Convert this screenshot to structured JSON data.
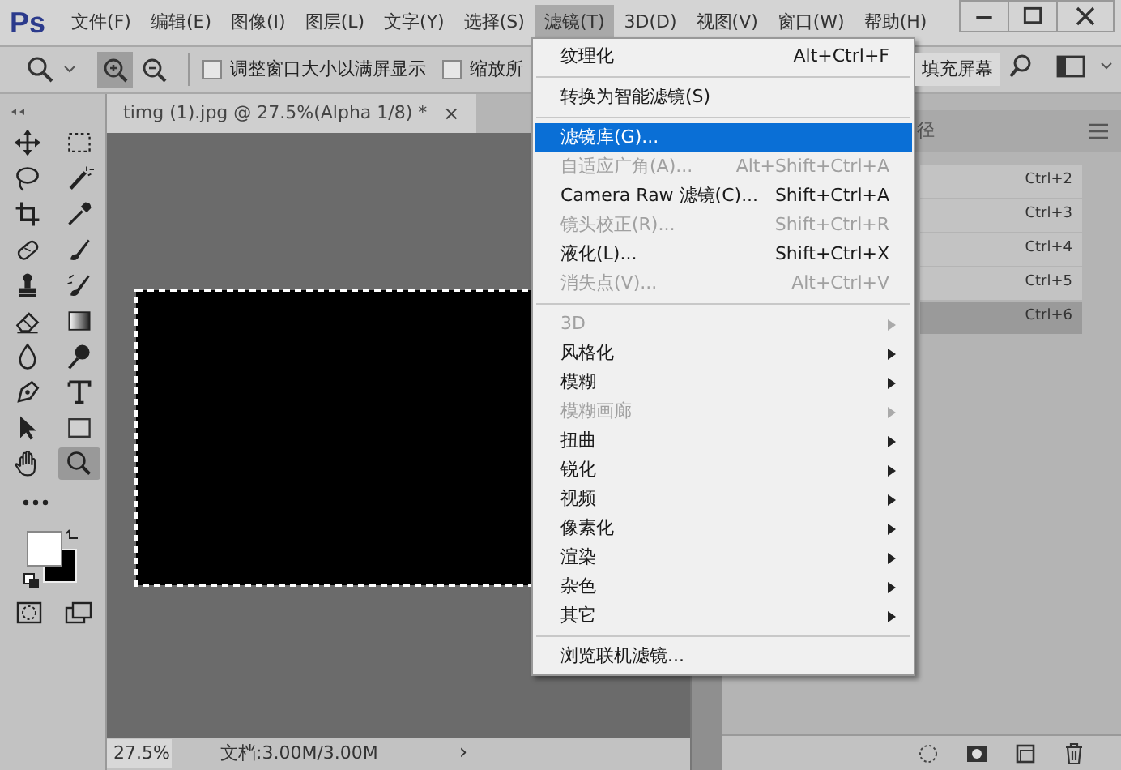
{
  "app": {
    "logo": "Ps"
  },
  "menubar": [
    {
      "label": "文件(F)",
      "selected": false
    },
    {
      "label": "编辑(E)",
      "selected": false
    },
    {
      "label": "图像(I)",
      "selected": false
    },
    {
      "label": "图层(L)",
      "selected": false
    },
    {
      "label": "文字(Y)",
      "selected": false
    },
    {
      "label": "选择(S)",
      "selected": false
    },
    {
      "label": "滤镜(T)",
      "selected": true
    },
    {
      "label": "3D(D)",
      "selected": false
    },
    {
      "label": "视图(V)",
      "selected": false
    },
    {
      "label": "窗口(W)",
      "selected": false
    },
    {
      "label": "帮助(H)",
      "selected": false
    }
  ],
  "options_bar": {
    "zoom_modes": [
      {
        "kind": "in",
        "selected": true
      },
      {
        "kind": "out",
        "selected": false
      }
    ],
    "checkboxes": [
      {
        "label": "调整窗口大小以满屏显示",
        "checked": false
      },
      {
        "label": "缩放所",
        "checked": false
      }
    ],
    "button": "填充屏幕"
  },
  "tools": [
    {
      "kind": "move",
      "selected": false
    },
    {
      "kind": "marquee",
      "selected": false
    },
    {
      "kind": "lasso",
      "selected": false
    },
    {
      "kind": "wand",
      "selected": false
    },
    {
      "kind": "crop",
      "selected": false
    },
    {
      "kind": "eyedropper",
      "selected": false
    },
    {
      "kind": "healing",
      "selected": false
    },
    {
      "kind": "brush",
      "selected": false
    },
    {
      "kind": "stamp",
      "selected": false
    },
    {
      "kind": "history",
      "selected": false
    },
    {
      "kind": "eraser",
      "selected": false
    },
    {
      "kind": "gradient",
      "selected": false
    },
    {
      "kind": "blur",
      "selected": false
    },
    {
      "kind": "dodge",
      "selected": false
    },
    {
      "kind": "pen",
      "selected": false
    },
    {
      "kind": "type",
      "selected": false
    },
    {
      "kind": "select",
      "selected": false
    },
    {
      "kind": "shape",
      "selected": false
    },
    {
      "kind": "hand",
      "selected": false
    },
    {
      "kind": "zoom",
      "selected": true
    }
  ],
  "document_tab": {
    "title": "timg (1).jpg @ 27.5%(Alpha 1/8) *",
    "close": "×"
  },
  "status_bar": {
    "zoom": "27.5%",
    "info": "文档:3.00M/3.00M",
    "arrow": "›"
  },
  "panel": {
    "tab": "径",
    "rows": [
      {
        "shortcut": "Ctrl+2",
        "selected": false
      },
      {
        "shortcut": "Ctrl+3",
        "selected": false
      },
      {
        "shortcut": "Ctrl+4",
        "selected": false
      },
      {
        "shortcut": "Ctrl+5",
        "selected": false
      },
      {
        "shortcut": "Ctrl+6",
        "selected": true
      }
    ]
  },
  "filter_menu": [
    {
      "kind": "item",
      "label": "纹理化",
      "shortcut": "Alt+Ctrl+F",
      "disabled": false,
      "selected": false
    },
    {
      "kind": "separator"
    },
    {
      "kind": "item",
      "label": "转换为智能滤镜(S)",
      "disabled": false,
      "selected": false
    },
    {
      "kind": "separator"
    },
    {
      "kind": "item",
      "label": "滤镜库(G)...",
      "disabled": false,
      "selected": true
    },
    {
      "kind": "item",
      "label": "自适应广角(A)...",
      "shortcut": "Alt+Shift+Ctrl+A",
      "disabled": true,
      "selected": false
    },
    {
      "kind": "item",
      "label": "Camera Raw 滤镜(C)...",
      "shortcut": "Shift+Ctrl+A",
      "disabled": false,
      "selected": false
    },
    {
      "kind": "item",
      "label": "镜头校正(R)...",
      "shortcut": "Shift+Ctrl+R",
      "disabled": true,
      "selected": false
    },
    {
      "kind": "item",
      "label": "液化(L)...",
      "shortcut": "Shift+Ctrl+X",
      "disabled": false,
      "selected": false
    },
    {
      "kind": "item",
      "label": "消失点(V)...",
      "shortcut": "Alt+Ctrl+V",
      "disabled": true,
      "selected": false
    },
    {
      "kind": "separator"
    },
    {
      "kind": "submenu",
      "label": "3D",
      "disabled": true,
      "selected": false
    },
    {
      "kind": "submenu",
      "label": "风格化",
      "disabled": false,
      "selected": false
    },
    {
      "kind": "submenu",
      "label": "模糊",
      "disabled": false,
      "selected": false
    },
    {
      "kind": "submenu",
      "label": "模糊画廊",
      "disabled": true,
      "selected": false
    },
    {
      "kind": "submenu",
      "label": "扭曲",
      "disabled": false,
      "selected": false
    },
    {
      "kind": "submenu",
      "label": "锐化",
      "disabled": false,
      "selected": false
    },
    {
      "kind": "submenu",
      "label": "视频",
      "disabled": false,
      "selected": false
    },
    {
      "kind": "submenu",
      "label": "像素化",
      "disabled": false,
      "selected": false
    },
    {
      "kind": "submenu",
      "label": "渲染",
      "disabled": false,
      "selected": false
    },
    {
      "kind": "submenu",
      "label": "杂色",
      "disabled": false,
      "selected": false
    },
    {
      "kind": "submenu",
      "label": "其它",
      "disabled": false,
      "selected": false
    },
    {
      "kind": "separator"
    },
    {
      "kind": "item",
      "label": "浏览联机滤镜...",
      "disabled": false,
      "selected": false
    }
  ]
}
